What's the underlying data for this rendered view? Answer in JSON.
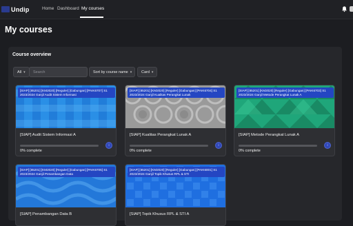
{
  "brand": {
    "name": "Undip"
  },
  "nav": {
    "home": "Home",
    "dashboard": "Dashboard",
    "my_courses": "My courses"
  },
  "page": {
    "title": "My courses"
  },
  "overview": {
    "title": "Course overview",
    "filter_label": "All",
    "search_placeholder": "Search",
    "sort_label": "Sort by course name",
    "view_label": "Card"
  },
  "courses": [
    {
      "tag": "[SIAP] [85201] [KM2020] [Reguler] [Gabungan] [PAIK6707] S1 2023/2024 Ganjil Audit Sistem Informasi",
      "name": "[SIAP] Audit Sistem Informasi A",
      "progress_text": "0% complete",
      "progress": 0.0,
      "pattern": "blue-plaid"
    },
    {
      "tag": "[SIAP] [85201] [KM2020] [Reguler] [Gabungan] [PAIK6704] S1 2023/2024 Ganjil Kualitas Perangkat Lunak",
      "name": "[SIAP] Kualitas Perangkat Lunak A",
      "progress_text": "0% complete",
      "progress": 0.0,
      "pattern": "grey-circles"
    },
    {
      "tag": "[SIAP] [85201] [KM2020] [Reguler] [Gabungan] [PAIK6703] S1 2023/2024 Ganjil Metode Perangkat Lunak A",
      "name": "[SIAP] Metode Perangkat Lunak A",
      "progress_text": "0% complete",
      "progress": 0.0,
      "pattern": "green-triangles"
    },
    {
      "tag": "[SIAP] [85201] [KM2020] [Reguler] [Gabungan] [PAIK6705] S1 2023/2024 Ganjil Penambangan Data",
      "name": "[SIAP] Penambangan Data B",
      "progress_text": "",
      "progress": 0.0,
      "pattern": "blue-waves"
    },
    {
      "tag": "[SIAP] [85201] [KM2020] [Reguler] [Gabungan] [PAIK6001] S1 2023/2024 Ganjil Topik Khusus RPL & STI",
      "name": "[SIAP] Topik Khusus RPL & STI A",
      "progress_text": "",
      "progress": 0.0,
      "pattern": "blue-grid"
    }
  ],
  "colors": {
    "topbar": "#202125",
    "background": "#1c1d21",
    "panel": "#26272b",
    "accent": "#2446c2"
  },
  "icons": {
    "notifications": "bell-icon",
    "more": "info-icon"
  }
}
